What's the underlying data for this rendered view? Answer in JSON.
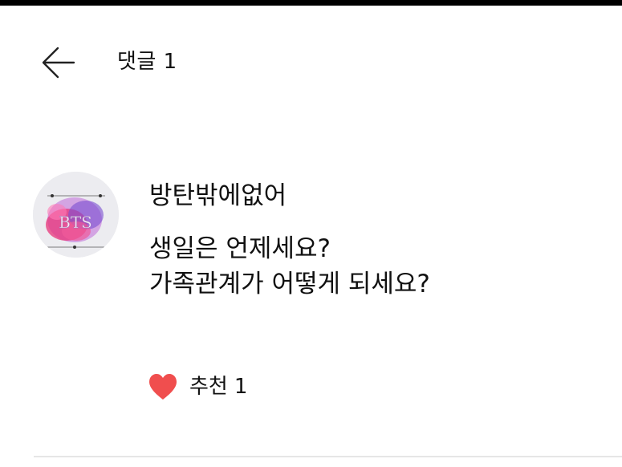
{
  "header": {
    "title": "댓글 1"
  },
  "comment": {
    "author": "방탄밖에없어",
    "avatar_text": "BTS",
    "body_lines": [
      "생일은 언제세요?",
      "가족관계가 어떻게 되세요?"
    ],
    "like": {
      "label": "추천",
      "count": "1"
    }
  },
  "colors": {
    "heart": "#f04e4e",
    "topbar": "#000000",
    "divider": "#e6e6e6"
  },
  "icons": {
    "back": "arrow-left-icon",
    "like": "heart-icon"
  }
}
